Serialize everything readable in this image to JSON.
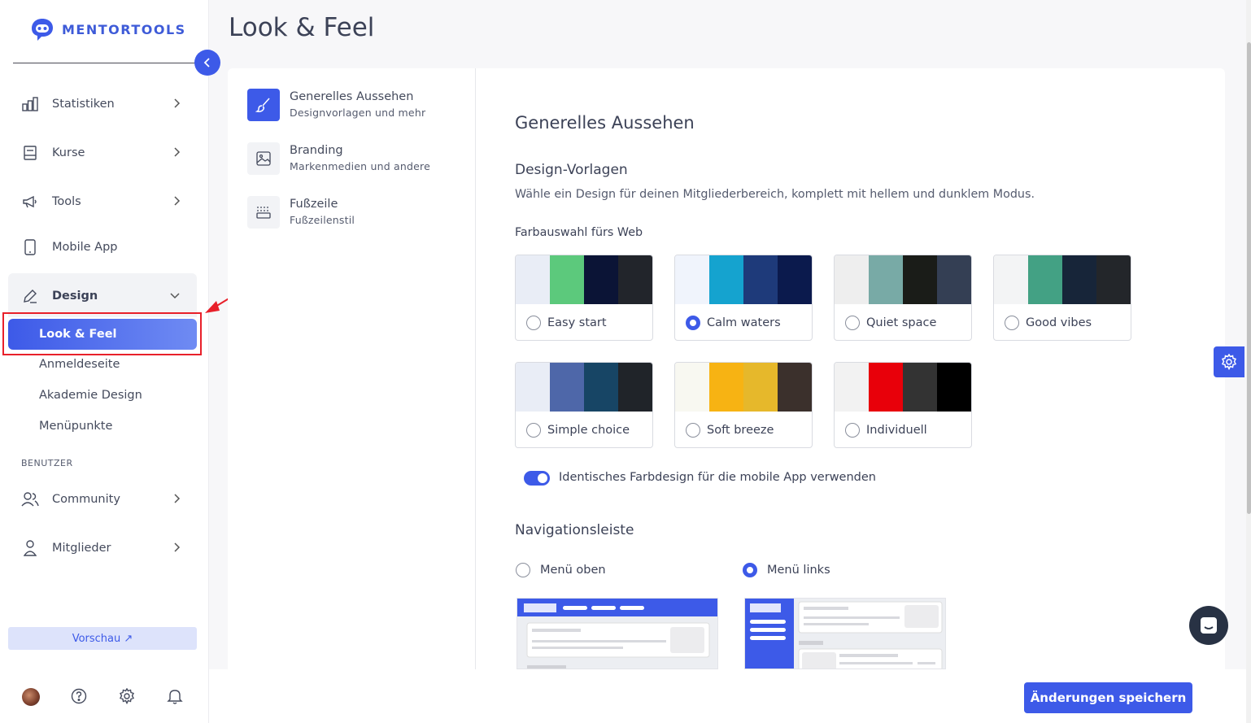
{
  "app": {
    "logo_text": "MENTORTOOLS",
    "accent": "#3d5ae8"
  },
  "sidebar": {
    "items": [
      {
        "label": "Statistiken",
        "icon": "bar-chart-icon"
      },
      {
        "label": "Kurse",
        "icon": "book-icon"
      },
      {
        "label": "Tools",
        "icon": "megaphone-icon"
      },
      {
        "label": "Mobile App",
        "icon": "phone-icon"
      },
      {
        "label": "Design",
        "icon": "edit-icon"
      }
    ],
    "design_sub": [
      "Look & Feel",
      "Anmeldeseite",
      "Akademie Design",
      "Menüpunkte"
    ],
    "section_label": "BENUTZER",
    "users_items": [
      {
        "label": "Community",
        "icon": "users-icon"
      },
      {
        "label": "Mitglieder",
        "icon": "user-icon"
      }
    ],
    "preview_label": "Vorschau ↗"
  },
  "page": {
    "title": "Look & Feel"
  },
  "subnav": [
    {
      "title": "Generelles Aussehen",
      "desc": "Designvorlagen und mehr"
    },
    {
      "title": "Branding",
      "desc": "Markenmedien und andere"
    },
    {
      "title": "Fußzeile",
      "desc": "Fußzeilenstil"
    }
  ],
  "content": {
    "heading": "Generelles Aussehen",
    "design_title": "Design-Vorlagen",
    "design_desc": "Wähle ein Design für deinen Mitgliederbereich, komplett mit hellem und dunklem Modus.",
    "color_label": "Farbauswahl fürs Web",
    "themes": [
      {
        "name": "Easy start",
        "colors": [
          "#e9edf6",
          "#5cc97c",
          "#0b1436",
          "#22252b"
        ],
        "selected": false
      },
      {
        "name": "Calm waters",
        "colors": [
          "#f0f4fc",
          "#15a3cf",
          "#1e3a7a",
          "#0b1a4d"
        ],
        "selected": true
      },
      {
        "name": "Quiet space",
        "colors": [
          "#eeeeee",
          "#78aaa6",
          "#1a1c18",
          "#343f54"
        ],
        "selected": false
      },
      {
        "name": "Good vibes",
        "colors": [
          "#f3f4f5",
          "#43a184",
          "#172539",
          "#23262a"
        ],
        "selected": false
      },
      {
        "name": "Simple choice",
        "colors": [
          "#e9edf6",
          "#4e67a9",
          "#174565",
          "#202429"
        ],
        "selected": false
      },
      {
        "name": "Soft breeze",
        "colors": [
          "#f8f8f1",
          "#f7b313",
          "#e6b82b",
          "#3b302c"
        ],
        "selected": false
      },
      {
        "name": "Individuell",
        "colors": [
          "#f2f2f2",
          "#e8000a",
          "#333333",
          "#000000"
        ],
        "selected": false
      }
    ],
    "toggle_label": "Identisches Farbdesign für die mobile App verwenden",
    "toggle_on": true,
    "nav_title": "Navigationsleiste",
    "nav_options": [
      {
        "label": "Menü oben",
        "selected": false
      },
      {
        "label": "Menü links",
        "selected": true
      }
    ]
  },
  "footer": {
    "save_label": "Änderungen speichern"
  }
}
